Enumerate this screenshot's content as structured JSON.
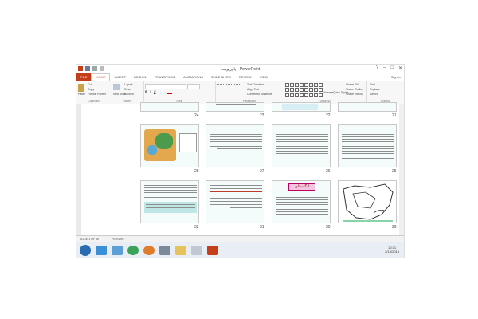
{
  "window": {
    "title": "پاورپوینت - PowerPoint",
    "sign_in": "Sign in"
  },
  "tabs": [
    "FILE",
    "HOME",
    "INSERT",
    "DESIGN",
    "TRANSITIONS",
    "ANIMATIONS",
    "SLIDE SHOW",
    "REVIEW",
    "VIEW"
  ],
  "ribbon": {
    "clipboard": {
      "paste": "Paste",
      "cut": "Cut",
      "copy": "Copy",
      "format_painter": "Format Painter",
      "label": "Clipboard"
    },
    "slides": {
      "new_slide": "New Slide",
      "layout": "Layout",
      "reset": "Reset",
      "section": "Section",
      "label": "Slides"
    },
    "font": {
      "label": "Font"
    },
    "paragraph": {
      "text_direction": "Text Direction",
      "align_text": "Align Text",
      "convert": "Convert to SmartArt",
      "label": "Paragraph"
    },
    "drawing": {
      "arrange": "Arrange",
      "quick_styles": "Quick Styles",
      "shape_fill": "Shape Fill",
      "shape_outline": "Shape Outline",
      "shape_effects": "Shape Effects",
      "label": "Drawing"
    },
    "editing": {
      "find": "Find",
      "replace": "Replace",
      "select": "Select",
      "label": "Editing"
    }
  },
  "slides": [
    {
      "number": "24"
    },
    {
      "number": "23"
    },
    {
      "number": "22"
    },
    {
      "number": "21"
    },
    {
      "number": "28"
    },
    {
      "number": "27"
    },
    {
      "number": "26"
    },
    {
      "number": "25"
    },
    {
      "number": "32"
    },
    {
      "number": "31"
    },
    {
      "number": "30"
    },
    {
      "number": "29"
    }
  ],
  "slide_30_title": "انگلستان",
  "status": {
    "slide": "SLIDE 1 OF 58",
    "lang": "PERSIAN"
  },
  "clock": {
    "time": "10:31",
    "date": "2/18/2015"
  },
  "colors": {
    "accent": "#c43e1c",
    "thumb_bg": "#f4fcfb"
  }
}
